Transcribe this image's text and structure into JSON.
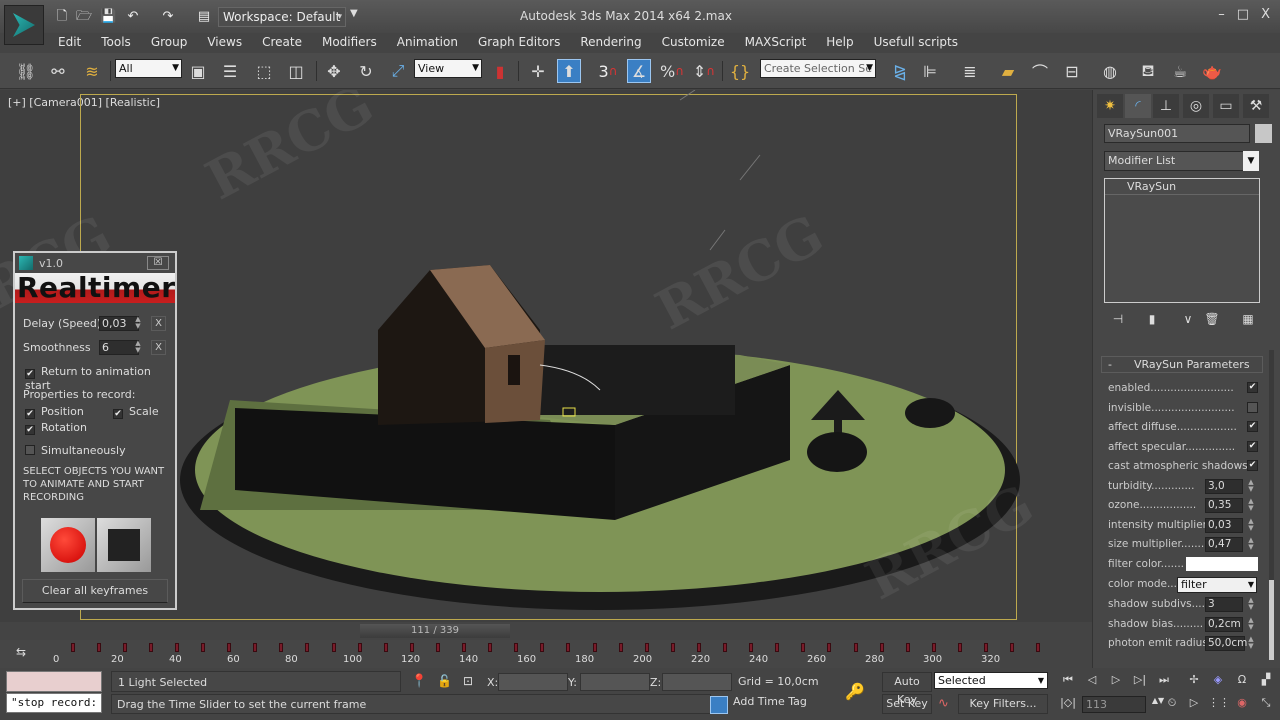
{
  "title_bar": {
    "app_title": "Autodesk 3ds Max  2014 x64     2.max",
    "workspace": "Workspace: Default",
    "window_controls": {
      "minimize": "–",
      "maximize": "□",
      "close": "X"
    },
    "quick_access_icons": [
      "new-file-icon",
      "open-folder-icon",
      "save-icon",
      "undo-icon",
      "redo-icon",
      "project-folder-icon"
    ]
  },
  "menu": [
    "Edit",
    "Tools",
    "Group",
    "Views",
    "Create",
    "Modifiers",
    "Animation",
    "Graph Editors",
    "Rendering",
    "Customize",
    "MAXScript",
    "Help",
    "Usefull scripts"
  ],
  "toolbar": {
    "selection_filter": "All",
    "reference_coord": "View",
    "named_selection_placeholder": "Create Selection Se",
    "snap_label": "3",
    "angle_snap_label": "%",
    "icons": [
      "link-icon",
      "unlink-icon",
      "bind-space-warp-icon",
      "select-object-icon",
      "select-by-name-icon",
      "rectangular-selection-icon",
      "window-crossing-icon",
      "move-icon",
      "rotate-icon",
      "scale-icon",
      "mirror-keys-icon",
      "pivot-icon",
      "manipulate-icon",
      "snap-toggle-icon",
      "angle-snap-icon",
      "percent-snap-icon",
      "spinner-snap-icon",
      "edit-named-selection-icon",
      "mirror-icon",
      "align-icon",
      "layer-manager-icon",
      "scene-explorer-icon",
      "curve-editor-icon",
      "schematic-view-icon",
      "material-editor-icon",
      "render-setup-icon",
      "rendered-frame-icon",
      "render-icon"
    ]
  },
  "viewport": {
    "label": "[+] [Camera001] [Realistic]",
    "scene_description": "House with fence on green disc ground, tree and rock, VRaySun light"
  },
  "realtimer": {
    "version": "v1.0",
    "banner": "Realtimer",
    "close_label": "☒",
    "delay_label": "Delay (Speed)",
    "delay_value": "0,03",
    "smoothness_label": "Smoothness",
    "smoothness_value": "6",
    "reset_label": "X",
    "return_to_start": {
      "label": "Return to animation start",
      "checked": true
    },
    "properties_heading": "Properties to record:",
    "position": {
      "label": "Position",
      "checked": true
    },
    "scale": {
      "label": "Scale",
      "checked": true
    },
    "rotation": {
      "label": "Rotation",
      "checked": true
    },
    "simultaneously": {
      "label": "Simultaneously",
      "checked": false
    },
    "instructions": "SELECT OBJECTS YOU WANT TO ANIMATE AND START RECORDING",
    "clear_label": "Clear all keyframes"
  },
  "command_panel": {
    "tabs": [
      "create-tab",
      "modify-tab",
      "hierarchy-tab",
      "motion-tab",
      "display-tab",
      "utilities-tab"
    ],
    "object_name": "VRaySun001",
    "modifier_list": "Modifier List",
    "stack": [
      "VRaySun"
    ],
    "rollout_title": "VRaySun Parameters",
    "rollout_minus": "-",
    "checkbox_params": [
      {
        "label": "enabled.........................",
        "checked": true
      },
      {
        "label": "invisible.........................",
        "checked": false
      },
      {
        "label": "affect diffuse..................",
        "checked": true
      },
      {
        "label": "affect specular...............",
        "checked": true
      },
      {
        "label": "cast atmospheric shadows..",
        "checked": true
      }
    ],
    "spinner_params": [
      {
        "label": "turbidity.............",
        "value": "3,0"
      },
      {
        "label": "ozone.................",
        "value": "0,35"
      },
      {
        "label": "intensity multiplier..",
        "value": "0,03"
      },
      {
        "label": "size multiplier........",
        "value": "0,47"
      }
    ],
    "filter_color_label": "filter color.......",
    "filter_color": "#ffffff",
    "color_mode_label": "color mode....",
    "color_mode_value": "filter",
    "lower_params": [
      {
        "label": "shadow subdivs....",
        "value": "3"
      },
      {
        "label": "shadow bias.........",
        "value": "0,2cm"
      },
      {
        "label": "photon emit radius.",
        "value": "50,0cm"
      }
    ]
  },
  "timeline": {
    "slider_label": "111 / 339",
    "current_frame": 111,
    "total_frames": 339,
    "ticks": [
      "0",
      "20",
      "40",
      "60",
      "80",
      "100",
      "120",
      "140",
      "160",
      "180",
      "200",
      "220",
      "240",
      "260",
      "280",
      "300",
      "320"
    ]
  },
  "status": {
    "maxscript_listener_output": "",
    "maxscript_listener_input": "\"stop record:",
    "selection": "1 Light Selected",
    "prompt": "Drag the Time Slider to set the current frame",
    "x_label": "X:",
    "y_label": "Y:",
    "z_label": "Z:",
    "grid": "Grid = 10,0cm",
    "add_time_tag": "Add Time Tag",
    "auto_key": "Auto Key",
    "set_key": "Set Key",
    "key_mode": "Selected",
    "key_filters": "Key Filters...",
    "frame_field": "113"
  },
  "colors": {
    "accent_blue": "#3a7fc4",
    "safe_frame": "#bda94e",
    "record_red": "#e0261a",
    "key_marker": "#7a1c2a"
  }
}
